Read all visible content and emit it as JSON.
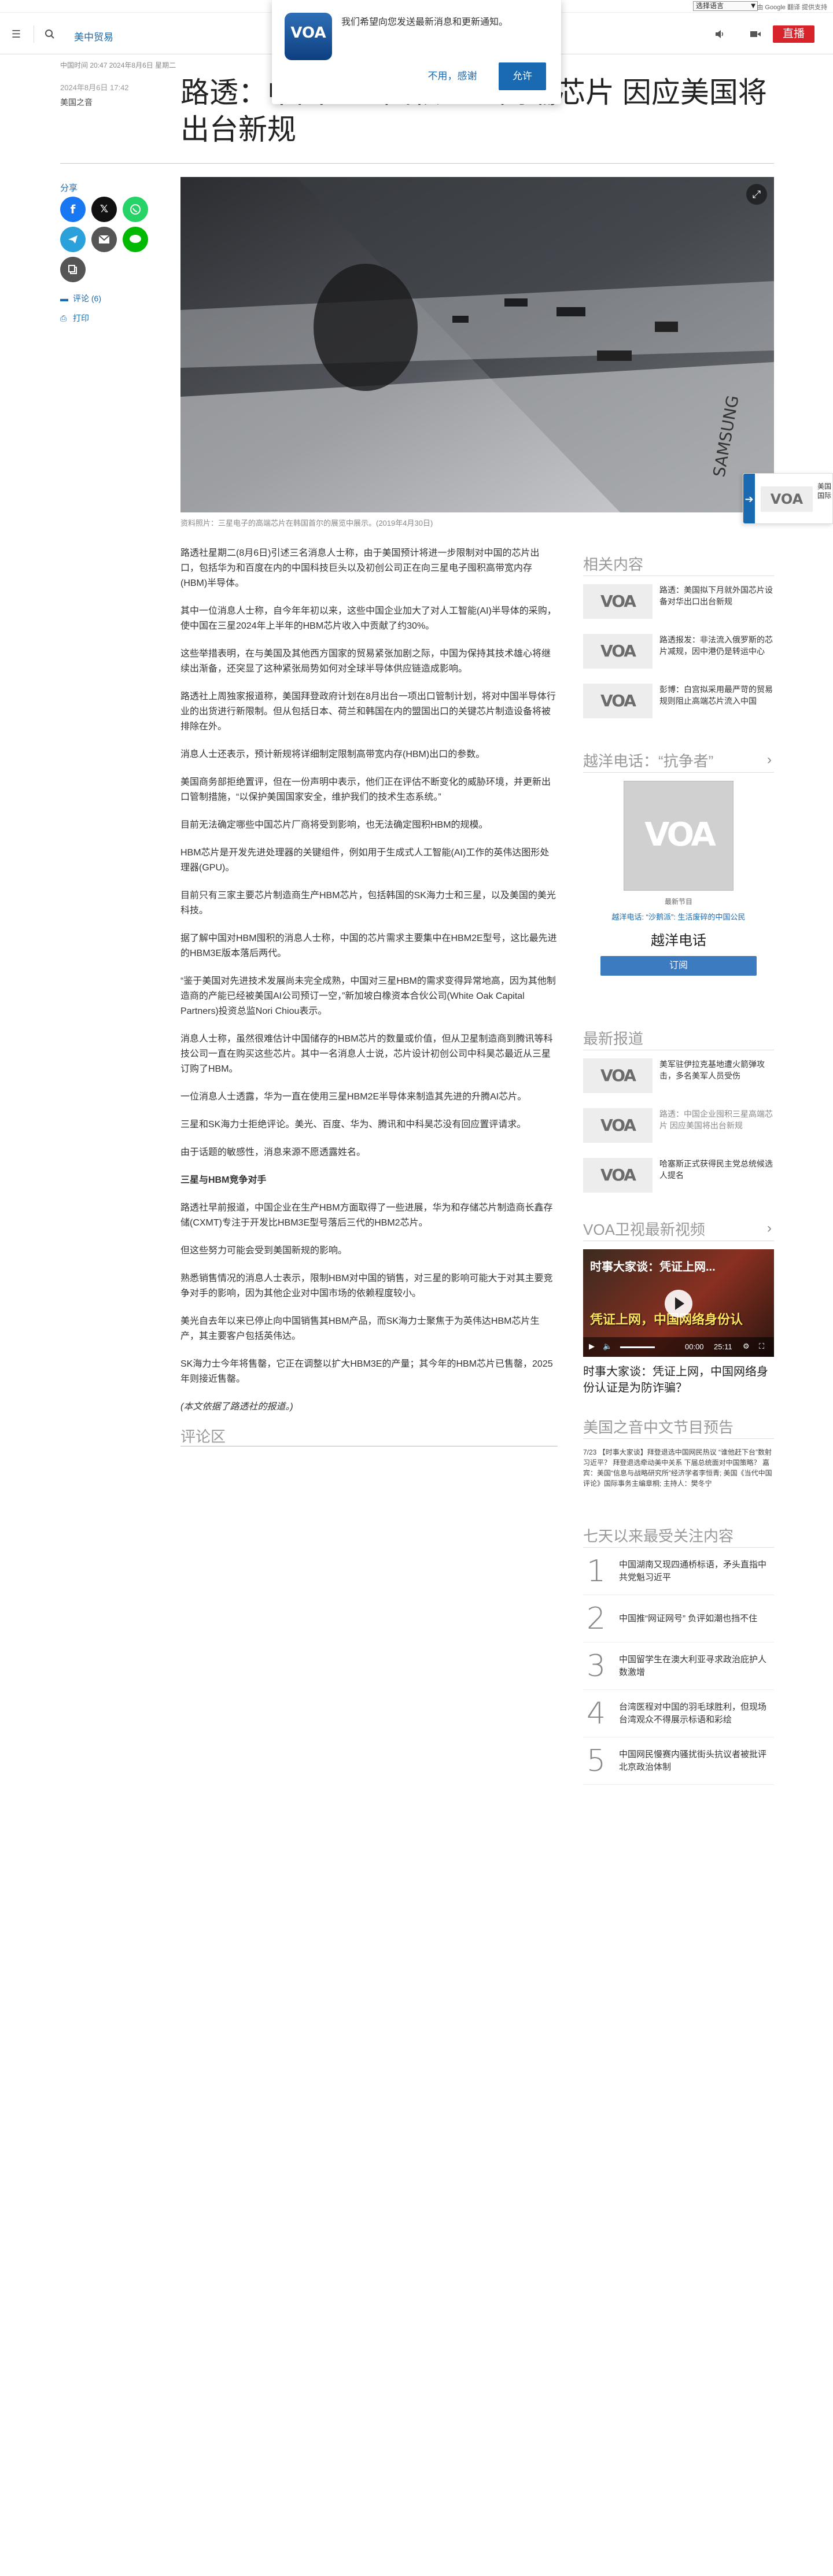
{
  "utility": {
    "language_select": "选择语言",
    "translate_tag": "由 Google 翻译 提供支持"
  },
  "header": {
    "menu_icon": "hamburger-menu-icon",
    "search_icon": "search-icon",
    "section": "美中贸易",
    "live_label": "直播",
    "audio_icon": "speaker-icon",
    "video_icon": "video-camera-icon"
  },
  "notification": {
    "logo_text": "VOA",
    "message": "我们希望向您发送最新消息和更新通知。",
    "cancel": "不用，感谢",
    "allow": "允许"
  },
  "article": {
    "meta": "中国时间 20:47 2024年8月6日 星期二",
    "date": "2024年8月6日 17:42",
    "author": "美国之音",
    "title": "路透：中国企业囤积三星高端芯片 因应美国将出台新规",
    "caption": "资料照片：三星电子的高端芯片在韩国首尔的展览中展示。(2019年4月30日)",
    "share_label": "分享",
    "comments_link": "评论 (6)",
    "print_link": "打印",
    "paragraphs": [
      "路透社星期二(8月6日)引述三名消息人士称，由于美国预计将进一步限制对中国的芯片出口，包括华为和百度在内的中国科技巨头以及初创公司正在向三星电子囤积高带宽内存(HBM)半导体。",
      "其中一位消息人士称，自今年年初以来，这些中国企业加大了对人工智能(AI)半导体的采购，使中国在三星2024年上半年的HBM芯片收入中贡献了约30%。",
      "这些举措表明，在与美国及其他西方国家的贸易紧张加剧之际，中国为保持其技术雄心将继续出渐备，还突显了这种紧张局势如何对全球半导体供应链造成影响。",
      "路透社上周独家报道称，美国拜登政府计划在8月出台一项出口管制计划，将对中国半导体行业的出货进行新限制。但从包括日本、荷兰和韩国在内的盟国出口的关键芯片制造设备将被排除在外。",
      "消息人士还表示，预计新规将详细制定限制高带宽内存(HBM)出口的参数。",
      "美国商务部拒绝置评，但在一份声明中表示，他们正在评估不断变化的威胁环境，并更新出口管制措施，“以保护美国国家安全，维护我们的技术生态系统。”",
      "目前无法确定哪些中国芯片厂商将受到影响，也无法确定囤积HBM的规模。",
      "HBM芯片是开发先进处理器的关键组件，例如用于生成式人工智能(AI)工作的英伟达图形处理器(GPU)。",
      "目前只有三家主要芯片制造商生产HBM芯片，包括韩国的SK海力士和三星，以及美国的美光科技。",
      "据了解中国对HBM囤积的消息人士称，中国的芯片需求主要集中在HBM2E型号，这比最先进的HBM3E版本落后两代。",
      "“鉴于美国对先进技术发展尚未完全成熟，中国对三星HBM的需求变得异常地高，因为其他制造商的产能已经被美国AI公司预订一空，”新加坡白橡资本合伙公司(White Oak Capital Partners)投资总监Nori Chiou表示。",
      "消息人士称，虽然很难估计中国储存的HBM芯片的数量或价值，但从卫星制造商到腾讯等科技公司一直在购买这些芯片。其中一名消息人士说，芯片设计初创公司中科昊芯最近从三星订购了HBM。",
      "一位消息人士透露，华为一直在使用三星HBM2E半导体来制造其先进的升腾AI芯片。",
      "三星和SK海力士拒绝评论。美光、百度、华为、腾讯和中科昊芯没有回应置评请求。",
      "由于话题的敏感性，消息来源不愿透露姓名。"
    ],
    "subheading": "三星与HBM竞争对手",
    "paragraphs2": [
      "路透社早前报道，中国企业在生产HBM方面取得了一些进展，华为和存储芯片制造商长鑫存储(CXMT)专注于开发比HBM3E型号落后三代的HBM2芯片。",
      "但这些努力可能会受到美国新规的影响。",
      "熟悉销售情况的消息人士表示，限制HBM对中国的销售，对三星的影响可能大于对其主要竞争对手的影响，因为其他企业对中国市场的依赖程度较小。",
      "美光自去年以来已停止向中国销售其HBM产品，而SK海力士聚焦于为英伟达HBM芯片生产，其主要客户包括英伟达。",
      "SK海力士今年将售罄，它正在调整以扩大HBM3E的产量；其今年的HBM芯片已售罄，2025年则接近售罄。"
    ],
    "note": "(本文依据了路透社的报道。)",
    "comments_title": "评论区"
  },
  "sidebar": {
    "related_title": "相关内容",
    "related": [
      "路透：美国拟下月就外国芯片设备对华出口出台新规",
      "路透报发：非法流入俄罗斯的芯片减规，因中港仍是转运中心",
      "彭博：白宫拟采用最严苛的贸易规则阻止高端芯片流入中国"
    ],
    "podcast_title": "越洋电话：“抗争者”",
    "podcast_label": "最新节目",
    "podcast_link": "越洋电话: “沙鹅派”: 生活废碎的中国公民",
    "podcast_name": "越洋电话",
    "subscribe": "订阅",
    "latest_title": "最新报道",
    "latest": [
      "美军驻伊拉克基地遭火箭弹攻击，多名美军人员受伤",
      "路透：中国企业囤积三星高端芯片 因应美国将出台新规",
      "哈塞斯正式获得民主党总统候选人提名"
    ],
    "video_title": "VOA卫视最新视频",
    "video_overlay": "时事大家谈：凭证上网...",
    "video_overlay2": "凭证上网，中国网络身份认",
    "video_caption": "时事大家谈：凭证上网，中国网络身份认证是为防诈骗？",
    "video_time": "00:00",
    "video_duration": "25:11",
    "schedule_title": "美国之音中文节目预告",
    "schedule": "7/23 【时事大家谈】拜登退选中国网民热议 “谁他赶下台”数射习近平？ 拜登退选牵动美中关系 下届总统面对中国策略？ 嘉宾：美国“信息与战略研究所”经济学者李恒青; 美国《当代中国评论》国际事务主编章桐; 主持人：樊冬宁",
    "popular_title": "七天以来最受关注内容",
    "popular": [
      {
        "n": "1",
        "t": "中国湖南又现四通桥标语，矛头直指中共党魁习近平"
      },
      {
        "n": "2",
        "t": "中国推“网证网号” 负评如潮也挡不住"
      },
      {
        "n": "3",
        "t": "中国留学生在澳大利亚寻求政治庇护人数激增"
      },
      {
        "n": "4",
        "t": "台湾医程对中国的羽毛球胜利，但现场台湾观众不得展示标语和彩绘"
      },
      {
        "n": "5",
        "t": "中国网民慢赛内骚扰街头抗议者被批评北京政治体制"
      }
    ]
  },
  "promo": {
    "text1": "美国",
    "text2": "国际"
  }
}
